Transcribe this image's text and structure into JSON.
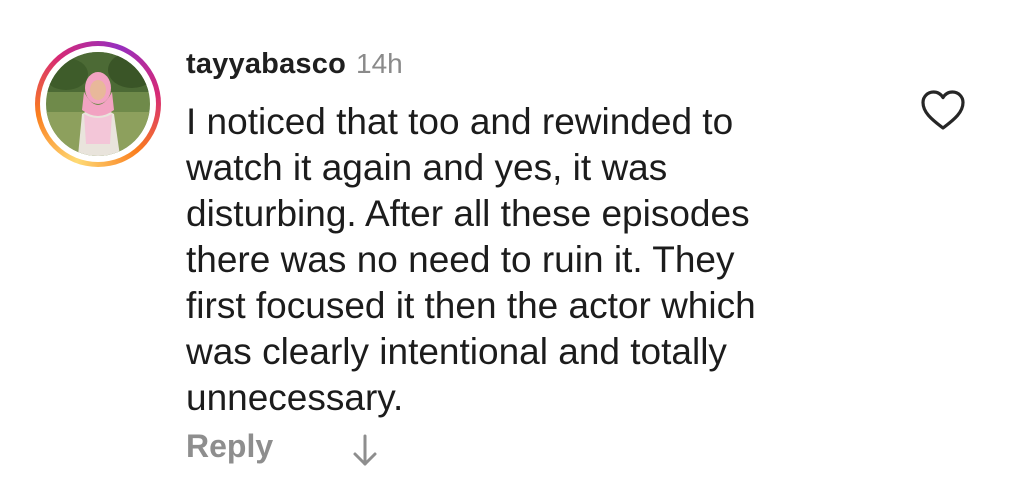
{
  "comment": {
    "username": "tayyabasco",
    "timestamp": "14h",
    "text_lines": [
      "I noticed that too and rewinded to",
      "watch it again and yes, it was",
      "disturbing. After all these episodes",
      "there was no need to ruin it. They",
      "first focused it then the actor which",
      "was clearly intentional and totally",
      "unnecessary."
    ],
    "reply_label": "Reply",
    "icons": {
      "like": "heart-icon",
      "translate": "arrow-down-icon",
      "avatar": "story-ring-avatar"
    }
  },
  "colors": {
    "text": "#1c1c1c",
    "muted": "#8e8e8e",
    "story_ring": [
      "#feda75",
      "#fa7e1e",
      "#d62976",
      "#962fbf"
    ]
  }
}
